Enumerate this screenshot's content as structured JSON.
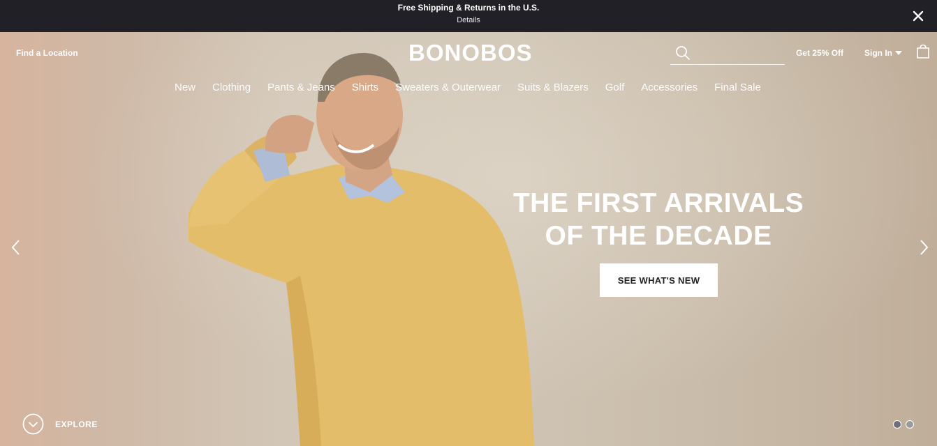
{
  "promo": {
    "title": "Free Shipping & Returns in the U.S.",
    "link": "Details"
  },
  "header": {
    "find_location": "Find a Location",
    "logo": "BONOBOS",
    "search_placeholder": "",
    "offer": "Get 25% Off",
    "sign_in": "Sign In"
  },
  "nav": {
    "items": [
      {
        "label": "New"
      },
      {
        "label": "Clothing"
      },
      {
        "label": "Pants & Jeans"
      },
      {
        "label": "Shirts"
      },
      {
        "label": "Sweaters & Outerwear"
      },
      {
        "label": "Suits & Blazers"
      },
      {
        "label": "Golf"
      },
      {
        "label": "Accessories"
      },
      {
        "label": "Final Sale"
      }
    ]
  },
  "hero": {
    "headline_line1": "THE FIRST ARRIVALS",
    "headline_line2": "OF THE DECADE",
    "cta": "SEE WHAT'S NEW",
    "explore": "EXPLORE",
    "slide_count": 2,
    "active_slide": 1
  },
  "icons": {
    "close": "close-icon",
    "search": "search-icon",
    "caret": "chevron-down-icon",
    "bag": "shopping-bag-icon",
    "prev": "chevron-left-icon",
    "next": "chevron-right-icon",
    "explore": "chevron-down-circle-icon"
  },
  "colors": {
    "promo_bg": "#222027",
    "cta_bg": "#ffffff",
    "cta_text": "#222222"
  }
}
